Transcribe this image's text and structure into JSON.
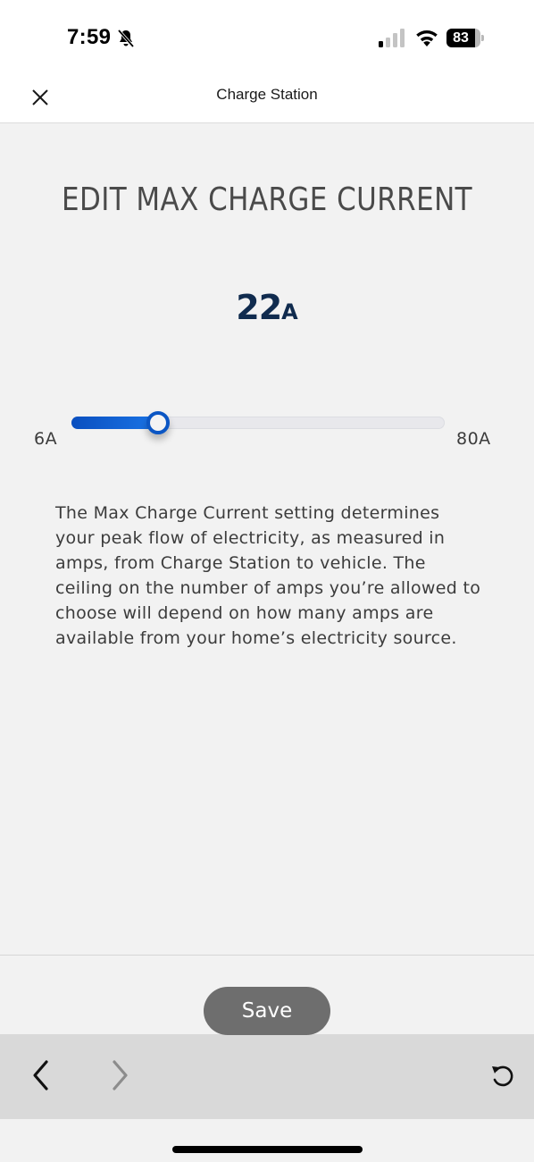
{
  "status_bar": {
    "time": "7:59",
    "silent_mode_icon": "bell-slash-icon",
    "signal_bars_active": 1,
    "signal_bars_total": 4,
    "wifi_icon": "wifi-icon",
    "battery_percent": "83"
  },
  "header": {
    "close_icon": "close-icon",
    "title": "Charge Station"
  },
  "main": {
    "title": "EDIT MAX CHARGE CURRENT",
    "current_value": "22",
    "current_unit": "A",
    "slider": {
      "min": 6,
      "max": 80,
      "value": 22,
      "min_label": "6A",
      "max_label": "80A",
      "accent_color": "#0b56c4"
    },
    "description": "The Max Charge Current setting determines your peak flow of electricity, as measured in amps, from Charge Station to vehicle. The ceiling on the number of amps you’re allowed to choose will depend on how many amps are available from your home’s electricity source."
  },
  "footer": {
    "save_label": "Save"
  },
  "browser_toolbar": {
    "back_icon": "chevron-left-icon",
    "forward_icon": "chevron-right-icon",
    "forward_enabled": false,
    "reload_icon": "reload-icon"
  }
}
